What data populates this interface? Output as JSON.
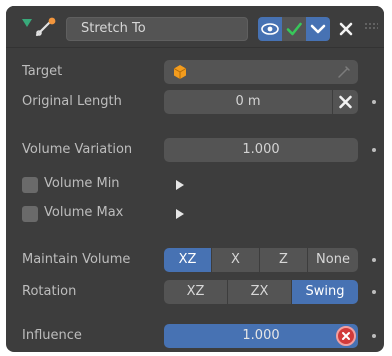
{
  "header": {
    "constraint_name": "Stretch To"
  },
  "fields": {
    "target_label": "Target",
    "original_length_label": "Original Length",
    "original_length_value": "0 m",
    "volume_variation_label": "Volume Variation",
    "volume_variation_value": "1.000",
    "volume_min_label": "Volume Min",
    "volume_max_label": "Volume Max",
    "maintain_volume_label": "Maintain Volume",
    "rotation_label": "Rotation",
    "influence_label": "Influence",
    "influence_value": "1.000"
  },
  "maintain_volume_options": [
    "XZ",
    "X",
    "Z",
    "None"
  ],
  "maintain_volume_selected": "XZ",
  "rotation_options": [
    "XZ",
    "ZX",
    "Swing"
  ],
  "rotation_selected": "Swing",
  "influence_fraction": 1.0,
  "colors": {
    "panel_bg": "#3d3d3d",
    "field_bg": "#545454",
    "accent_blue": "#4772b3",
    "check_green": "#38c75a",
    "delete_red": "#d23a3a",
    "object_orange": "#f39c1d"
  },
  "icons": [
    "collapse-triangle-icon",
    "constraint-icon",
    "eye-icon",
    "check-icon",
    "chevron-down-icon",
    "close-icon",
    "grip-icon",
    "object-cube-icon",
    "eyedropper-icon",
    "clear-x-icon",
    "play-icon",
    "remove-circle-icon"
  ]
}
